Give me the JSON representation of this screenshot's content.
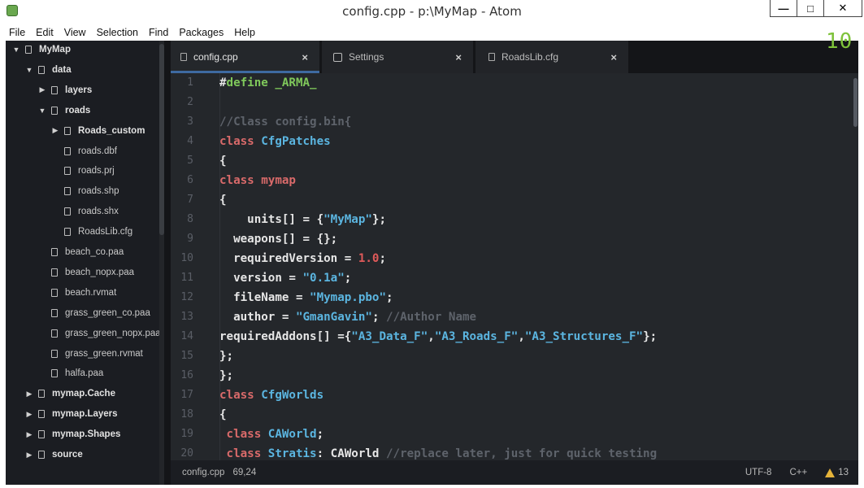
{
  "window": {
    "title": "config.cpp - p:\\MyMap - Atom",
    "minimize": "—",
    "maximize": "□",
    "close": "✕"
  },
  "menu": [
    "File",
    "Edit",
    "View",
    "Selection",
    "Find",
    "Packages",
    "Help"
  ],
  "tree": [
    {
      "label": "MyMap",
      "type": "dir",
      "expanded": true,
      "level": 0
    },
    {
      "label": "data",
      "type": "dir",
      "expanded": true,
      "level": 1
    },
    {
      "label": "layers",
      "type": "dir",
      "expanded": false,
      "level": 2
    },
    {
      "label": "roads",
      "type": "dir",
      "expanded": true,
      "level": 2
    },
    {
      "label": "Roads_custom",
      "type": "dir",
      "expanded": false,
      "level": 3
    },
    {
      "label": "roads.dbf",
      "type": "file",
      "level": 3
    },
    {
      "label": "roads.prj",
      "type": "file",
      "level": 3
    },
    {
      "label": "roads.shp",
      "type": "file",
      "level": 3
    },
    {
      "label": "roads.shx",
      "type": "file",
      "level": 3
    },
    {
      "label": "RoadsLib.cfg",
      "type": "file",
      "level": 3
    },
    {
      "label": "beach_co.paa",
      "type": "file",
      "level": 2
    },
    {
      "label": "beach_nopx.paa",
      "type": "file",
      "level": 2
    },
    {
      "label": "beach.rvmat",
      "type": "file",
      "level": 2
    },
    {
      "label": "grass_green_co.paa",
      "type": "file",
      "level": 2
    },
    {
      "label": "grass_green_nopx.paa",
      "type": "file",
      "level": 2
    },
    {
      "label": "grass_green.rvmat",
      "type": "file",
      "level": 2
    },
    {
      "label": "halfa.paa",
      "type": "file",
      "level": 2
    },
    {
      "label": "mymap.Cache",
      "type": "dir",
      "expanded": false,
      "level": 1
    },
    {
      "label": "mymap.Layers",
      "type": "dir",
      "expanded": false,
      "level": 1
    },
    {
      "label": "mymap.Shapes",
      "type": "dir",
      "expanded": false,
      "level": 1
    },
    {
      "label": "source",
      "type": "dir",
      "expanded": false,
      "level": 1
    }
  ],
  "tabs": [
    {
      "label": "config.cpp",
      "active": true,
      "icon": "file-icon"
    },
    {
      "label": "Settings",
      "active": false,
      "icon": "settings-icon"
    },
    {
      "label": "RoadsLib.cfg",
      "active": false,
      "icon": "file-icon"
    }
  ],
  "tab_close": "×",
  "editor": {
    "lines": [
      [
        [
          "#",
          "pp"
        ],
        [
          "define",
          "ppk"
        ],
        [
          " _ARMA_",
          "ppk"
        ]
      ],
      [],
      [
        [
          "//Class config.bin{",
          "com"
        ]
      ],
      [
        [
          "class ",
          "kw"
        ],
        [
          "CfgPatches",
          "cls"
        ]
      ],
      [
        [
          "{",
          ""
        ]
      ],
      [
        [
          "class ",
          "kw"
        ],
        [
          "mymap",
          "kw"
        ]
      ],
      [
        [
          "{",
          ""
        ]
      ],
      [
        [
          "    units[] = {",
          ""
        ],
        [
          "\"MyMap\"",
          "str"
        ],
        [
          "};",
          ""
        ]
      ],
      [
        [
          "  weapons[] = {};",
          ""
        ]
      ],
      [
        [
          "  requiredVersion = ",
          ""
        ],
        [
          "1.0",
          "num"
        ],
        [
          ";",
          ""
        ]
      ],
      [
        [
          "  version = ",
          ""
        ],
        [
          "\"0.1a\"",
          "str"
        ],
        [
          ";",
          ""
        ]
      ],
      [
        [
          "  fileName = ",
          ""
        ],
        [
          "\"Mymap.pbo\"",
          "str"
        ],
        [
          ";",
          ""
        ]
      ],
      [
        [
          "  author = ",
          ""
        ],
        [
          "\"GmanGavin\"",
          "str"
        ],
        [
          "; ",
          ""
        ],
        [
          "//Author Name",
          "com"
        ]
      ],
      [
        [
          "requiredAddons[] ={",
          ""
        ],
        [
          "\"A3_Data_F\"",
          "str"
        ],
        [
          ",",
          ""
        ],
        [
          "\"A3_Roads_F\"",
          "str"
        ],
        [
          ",",
          ""
        ],
        [
          "\"A3_Structures_F\"",
          "str"
        ],
        [
          "};",
          ""
        ]
      ],
      [
        [
          "};",
          ""
        ]
      ],
      [
        [
          "};",
          ""
        ]
      ],
      [
        [
          "class ",
          "kw"
        ],
        [
          "CfgWorlds",
          "cls"
        ]
      ],
      [
        [
          "{",
          ""
        ]
      ],
      [
        [
          " class ",
          "kw"
        ],
        [
          "CAWorld",
          "cls"
        ],
        [
          ";",
          ""
        ]
      ],
      [
        [
          " class ",
          "kw"
        ],
        [
          "Stratis",
          "cls"
        ],
        [
          ": CAWorld ",
          ""
        ],
        [
          "//replace later, just for quick testing",
          "com"
        ]
      ]
    ]
  },
  "status": {
    "file": "config.cpp",
    "cursor": "69,24",
    "encoding": "UTF-8",
    "grammar": "C++",
    "warnings": "13"
  },
  "overlay_logo": "10",
  "colors": {
    "keyword": "#d96a6a",
    "class": "#5bb5e0",
    "string": "#5bb5e0",
    "number": "#e05a5a",
    "comment": "#5e636b",
    "accent": "#3e6aa1",
    "warning": "#e5b33a"
  }
}
